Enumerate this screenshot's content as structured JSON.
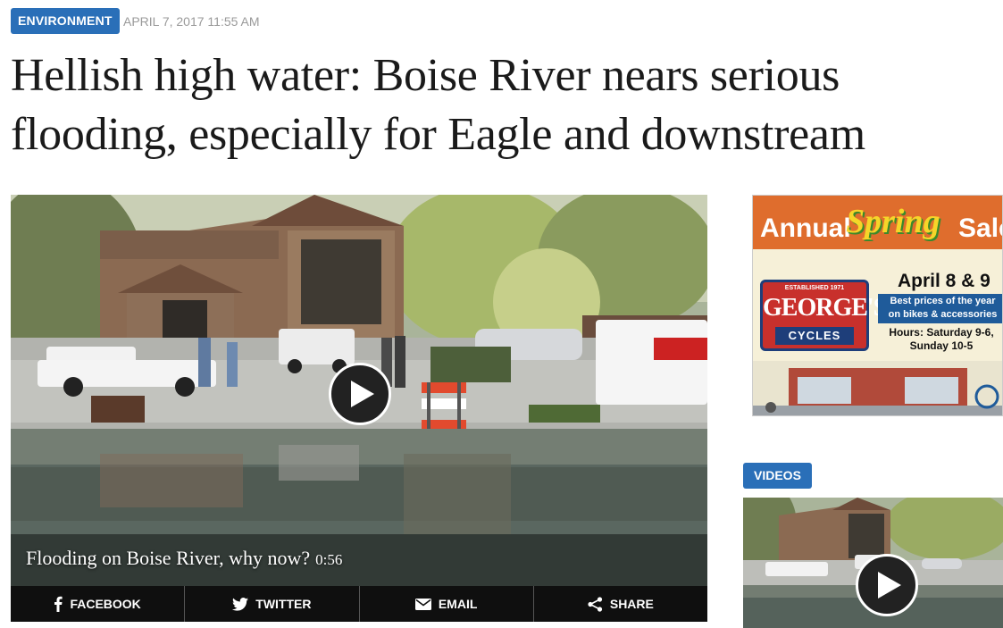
{
  "article": {
    "category": "ENVIRONMENT",
    "dateline": "APRIL 7, 2017 11:55 AM",
    "headline": "Hellish high water: Boise River nears serious flooding, especially for Eagle and downstream"
  },
  "video": {
    "caption": "Flooding on Boise River, why now?",
    "duration": "0:56",
    "play_icon": "play-icon"
  },
  "share_bar": [
    {
      "label": "FACEBOOK",
      "icon": "facebook-icon"
    },
    {
      "label": "TWITTER",
      "icon": "twitter-icon"
    },
    {
      "label": "EMAIL",
      "icon": "envelope-icon"
    },
    {
      "label": "SHARE",
      "icon": "share-icon"
    }
  ],
  "ad": {
    "annual": "Annual",
    "spring": "Spring",
    "sale": "Sale",
    "established": "ESTABLISHED 1971",
    "brand": "GEORGE'S",
    "cycles": "CYCLES",
    "dates": "April 8 & 9",
    "best_prices_line1": "Best prices of the year",
    "best_prices_line2": "on bikes & accessories",
    "hours_line1": "Hours: Saturday 9-6,",
    "hours_line2": "Sunday 10-5"
  },
  "sidebar": {
    "videos_label": "VIDEOS"
  },
  "colors": {
    "accent_blue": "#2a6fb8",
    "share_bar": "#0f0f0f",
    "headline": "#1a1a1a"
  }
}
